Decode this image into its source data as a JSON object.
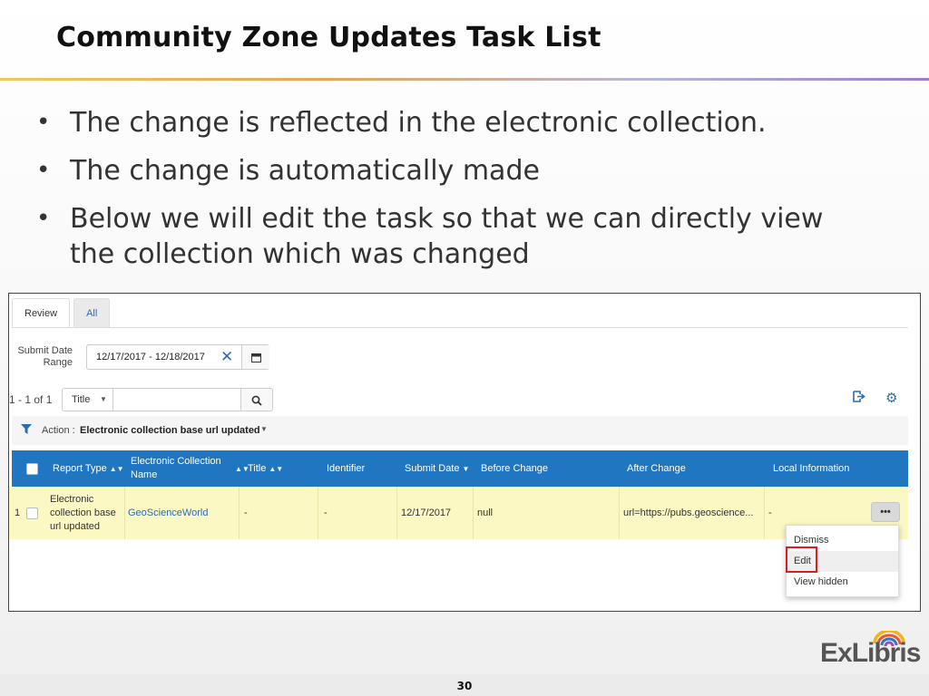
{
  "slide": {
    "title": "Community Zone Updates Task List",
    "bullets": [
      "The change is reflected in the electronic collection.",
      "The change is automatically made",
      "Below we will edit the task so that we can directly view the collection which was changed"
    ],
    "page_number": "30",
    "logo_text": "ExLibris"
  },
  "app": {
    "tabs": [
      {
        "label": "Review",
        "active": true
      },
      {
        "label": "All",
        "active": false
      }
    ],
    "submit_date_range_label": "Submit Date Range",
    "submit_date_range_value": "12/17/2017 - 12/18/2017",
    "result_count": "1 - 1 of 1",
    "search_field_select": "Title",
    "search_value": "",
    "filter_label": "Action :",
    "filter_value": "Electronic collection base url updated",
    "columns": [
      "Report Type",
      "Electronic Collection Name",
      "Title",
      "Identifier",
      "Submit Date",
      "Before Change",
      "After Change",
      "Local Information"
    ],
    "rows": [
      {
        "index": "1",
        "report_type": "Electronic collection base url updated",
        "collection_name": "GeoScienceWorld",
        "title": "-",
        "identifier": "-",
        "submit_date": "12/17/2017",
        "before_change": "null",
        "after_change": "url=https://pubs.geoscience...",
        "local_information": "-"
      }
    ],
    "actions_button": "•••",
    "row_menu": [
      "Dismiss",
      "Edit",
      "View hidden"
    ]
  },
  "colors": {
    "header_blue": "#2176c1",
    "row_highlight": "#fbf8c4",
    "link_blue": "#2a6db5",
    "highlight_red": "#e01b1b"
  }
}
